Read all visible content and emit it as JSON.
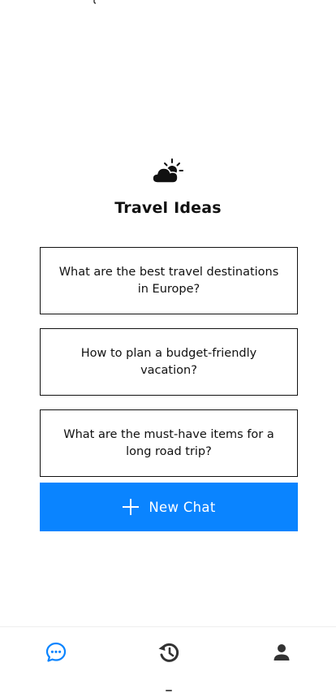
{
  "hero": {
    "icon": "partly-cloudy-icon",
    "title": "Travel Ideas"
  },
  "suggestions": [
    "What are the best travel destinations in Europe?",
    "How to plan a budget-friendly vacation?",
    "What are the must-have items for a long road trip?"
  ],
  "new_chat": {
    "icon": "plus-icon",
    "label": "New Chat"
  },
  "tabbar": {
    "items": [
      {
        "icon": "chat-bubble-icon",
        "active": true
      },
      {
        "icon": "history-icon",
        "active": false
      },
      {
        "icon": "profile-icon",
        "active": false
      }
    ]
  },
  "colors": {
    "accent": "#0a84ff",
    "text": "#111111",
    "background": "#ffffff",
    "inactive_icon": "#333333"
  }
}
